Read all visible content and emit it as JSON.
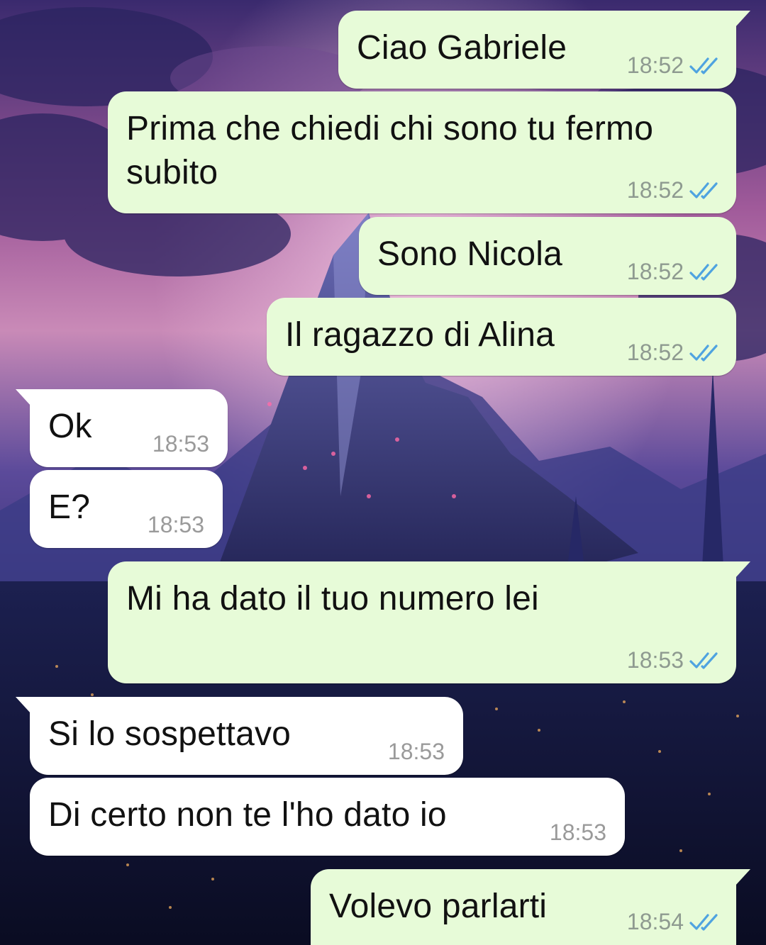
{
  "colors": {
    "outgoing_bubble": "#e7fbd8",
    "incoming_bubble": "#ffffff",
    "read_ticks": "#4fa3e0",
    "time_text": "#8e9a90"
  },
  "wallpaper": {
    "icon": "fantasy-mountain-night-wallpaper"
  },
  "messages": [
    {
      "dir": "out",
      "text": "Ciao Gabriele",
      "time": "18:52",
      "status": "read",
      "status_icon": "double-check-icon"
    },
    {
      "dir": "out",
      "text": "Prima che chiedi chi sono tu fermo subito",
      "time": "18:52",
      "status": "read",
      "status_icon": "double-check-icon"
    },
    {
      "dir": "out",
      "text": "Sono Nicola",
      "time": "18:52",
      "status": "read",
      "status_icon": "double-check-icon"
    },
    {
      "dir": "out",
      "text": "Il ragazzo di Alina",
      "time": "18:52",
      "status": "read",
      "status_icon": "double-check-icon"
    },
    {
      "dir": "in",
      "text": "Ok",
      "time": "18:53"
    },
    {
      "dir": "in",
      "text": "E?",
      "time": "18:53"
    },
    {
      "dir": "out",
      "text": "Mi ha dato il tuo numero lei",
      "time": "18:53",
      "status": "read",
      "status_icon": "double-check-icon"
    },
    {
      "dir": "in",
      "text": "Si lo sospettavo",
      "time": "18:53"
    },
    {
      "dir": "in",
      "text": "Di certo non te l'ho dato io",
      "time": "18:53"
    },
    {
      "dir": "out",
      "text": "Volevo parlarti",
      "time": "18:54",
      "status": "read",
      "status_icon": "double-check-icon"
    }
  ]
}
